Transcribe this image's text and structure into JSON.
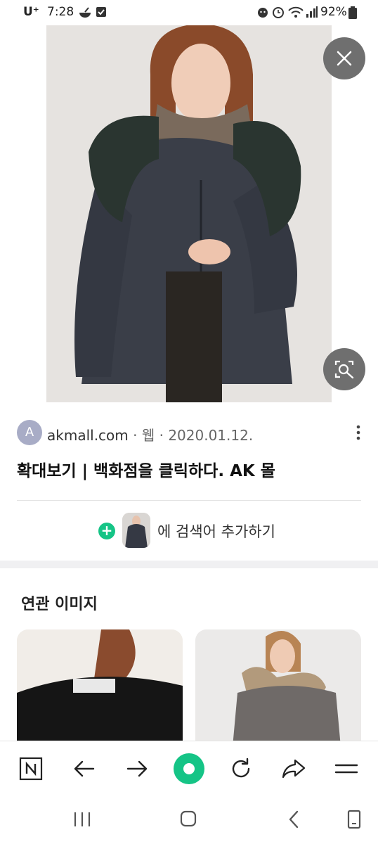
{
  "status_bar": {
    "carrier": "U⁺",
    "time": "7:28",
    "battery": "92%"
  },
  "result": {
    "source_initial": "A",
    "source_domain": "akmall.com",
    "separator": "·",
    "source_type": "웹",
    "date": "2020.01.12.",
    "title": "확대보기 | 백화점을 클릭하다. AK 몰",
    "add_search_term": "에 검색어 추가하기"
  },
  "related": {
    "title": "연관 이미지"
  },
  "icons": [
    "close-icon",
    "image-search-icon",
    "more-vert-icon",
    "plus-icon",
    "naver-n-icon",
    "back-arrow-icon",
    "forward-arrow-icon",
    "green-dot-icon",
    "refresh-icon",
    "share-icon",
    "menu-icon",
    "recent-apps-icon",
    "home-icon",
    "back-icon",
    "screenshot-icon"
  ],
  "colors": {
    "accent_green": "#15c486",
    "overlay_button": "#6f6f6f"
  }
}
